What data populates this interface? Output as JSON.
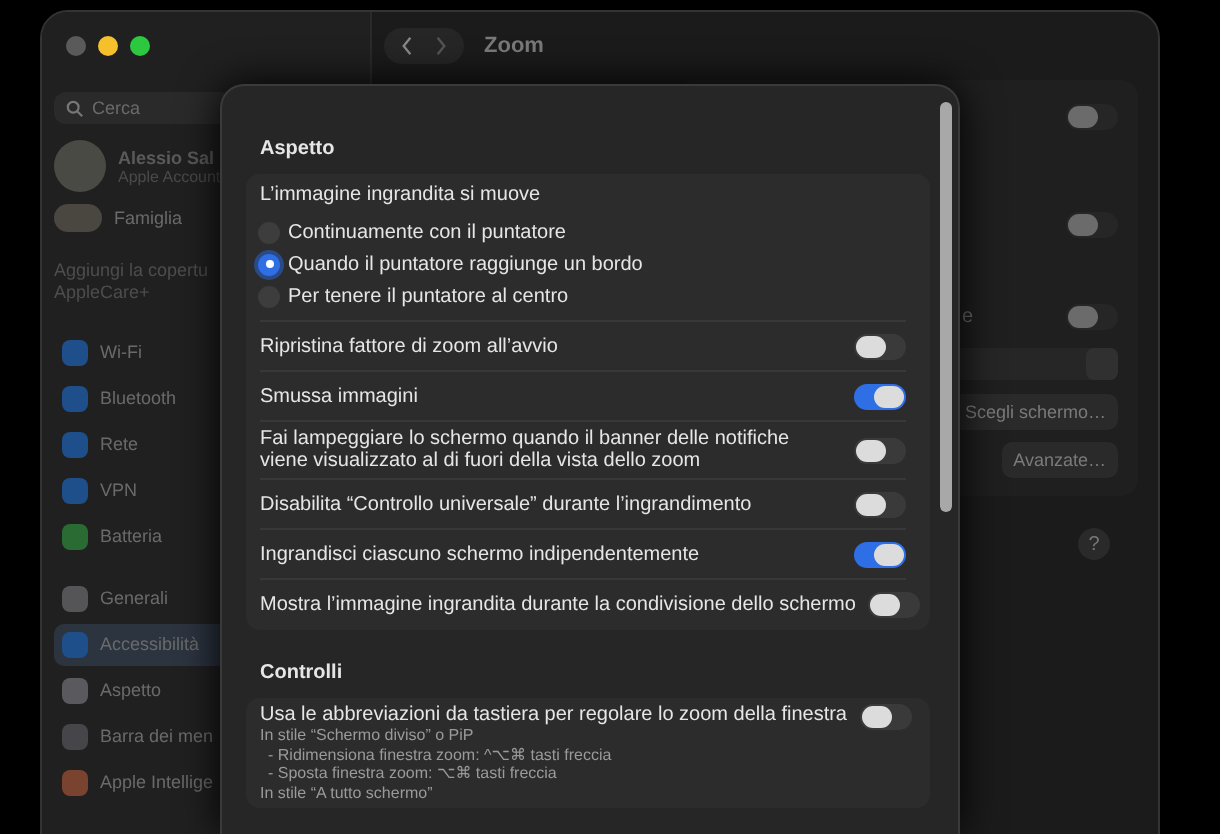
{
  "window": {
    "title": "Zoom"
  },
  "sidebar": {
    "search": {
      "placeholder": "Cerca"
    },
    "account": {
      "name": "Alessio Sal",
      "subtitle": "Apple Account"
    },
    "family": "Famiglia",
    "promo": "Aggiungi la copertu AppleCare+",
    "groups": [
      [
        {
          "label": "Wi-Fi",
          "color": "#1f4f8a",
          "selected": false
        },
        {
          "label": "Bluetooth",
          "color": "#1f4f8a",
          "selected": false
        },
        {
          "label": "Rete",
          "color": "#1f4f8a",
          "selected": false
        },
        {
          "label": "VPN",
          "color": "#1f4f8a",
          "selected": false
        },
        {
          "label": "Batteria",
          "color": "#2a6a33",
          "selected": false
        }
      ],
      [
        {
          "label": "Generali",
          "color": "#555558",
          "selected": false
        },
        {
          "label": "Accessibilità",
          "color": "#1f4f8a",
          "selected": true
        },
        {
          "label": "Aspetto",
          "color": "#5a5a5e",
          "selected": false
        },
        {
          "label": "Barra dei men",
          "color": "#46464a",
          "selected": false
        },
        {
          "label": "Apple Intellige",
          "color": "#7a4330",
          "selected": false
        }
      ]
    ]
  },
  "pane": {
    "toggles": [
      {
        "on": false
      },
      {
        "on": false
      },
      {
        "on": false
      }
    ],
    "partial_label": "e",
    "buttons": [
      "Scegli schermo…",
      "Avanzate…"
    ],
    "help": "?"
  },
  "sheet": {
    "sections": [
      {
        "title": "Aspetto",
        "radio": {
          "label": "L’immagine ingrandita si muove",
          "options": [
            {
              "label": "Continuamente con il puntatore",
              "selected": false
            },
            {
              "label": "Quando il puntatore raggiunge un bordo",
              "selected": true
            },
            {
              "label": "Per tenere il puntatore al centro",
              "selected": false
            }
          ]
        },
        "toggles": [
          {
            "label": "Ripristina fattore di zoom all’avvio",
            "on": false
          },
          {
            "label": "Smussa immagini",
            "on": true
          },
          {
            "label": "Fai lampeggiare lo schermo quando il banner delle notifiche viene visualizzato al di fuori della vista dello zoom",
            "on": false
          },
          {
            "label": "Disabilita “Controllo universale” durante l’ingrandimento",
            "on": false
          },
          {
            "label": "Ingrandisci ciascuno schermo indipendentemente",
            "on": true
          },
          {
            "label": "Mostra l’immagine ingrandita durante la condivisione dello schermo",
            "on": false
          }
        ]
      },
      {
        "title": "Controlli",
        "toggles": [
          {
            "label": "Usa le abbreviazioni da tastiera per regolare lo zoom della finestra",
            "on": false,
            "notes": [
              {
                "kind": "heading",
                "text": "In stile “Schermo diviso” o PiP"
              },
              {
                "kind": "bullet",
                "text": "- Ridimensiona finestra zoom: ^⌥⌘ tasti freccia"
              },
              {
                "kind": "bullet",
                "text": "- Sposta finestra zoom: ⌥⌘ tasti freccia"
              },
              {
                "kind": "heading",
                "text": "In stile “A tutto schermo”"
              }
            ]
          }
        ]
      }
    ]
  }
}
